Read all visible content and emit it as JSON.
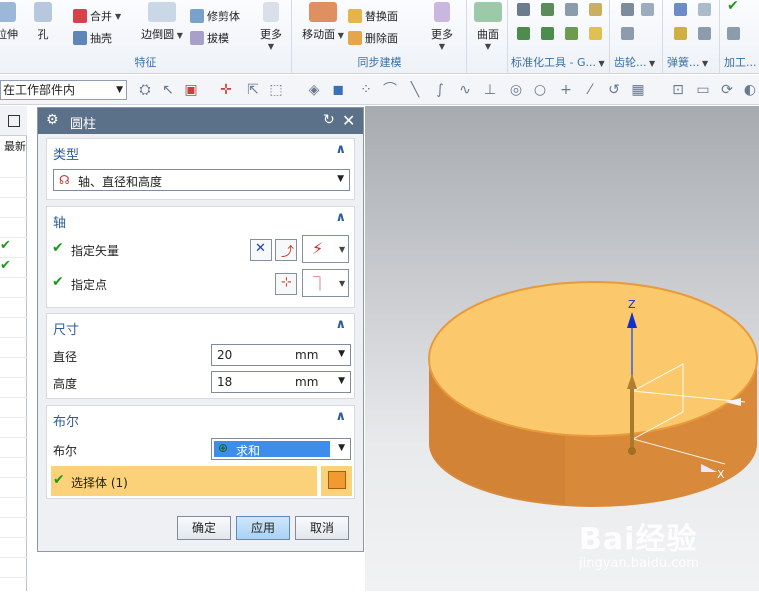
{
  "ribbon": {
    "features": {
      "label": "特征",
      "extrude_partial": "拉伸",
      "hole": "孔",
      "unite": "合并",
      "shell": "抽壳",
      "edge_blend": "边倒圆",
      "trim_body": "修剪体",
      "draft": "拔模",
      "more": "更多"
    },
    "sync": {
      "label": "同步建模",
      "move_face": "移动面",
      "replace_face": "替换面",
      "delete_face": "删除面",
      "more": "更多"
    },
    "surface": {
      "label": "曲面"
    },
    "std_tools": {
      "label": "标准化工具 - G..."
    },
    "gear": {
      "label": "齿轮..."
    },
    "spring": {
      "label": "弹簧..."
    },
    "machining": {
      "label": "加工..."
    }
  },
  "toolbar": {
    "scope": "在工作部件内"
  },
  "navigator": {
    "col_header": "最新"
  },
  "dialog": {
    "title": "圆柱",
    "type_section": {
      "title": "类型",
      "value": "轴、直径和高度"
    },
    "axis_section": {
      "title": "轴",
      "vector_label": "指定矢量",
      "point_label": "指定点"
    },
    "size_section": {
      "title": "尺寸",
      "diameter_label": "直径",
      "diameter_value": "20",
      "diameter_unit": "mm",
      "height_label": "高度",
      "height_value": "18",
      "height_unit": "mm"
    },
    "boolean_section": {
      "title": "布尔",
      "label": "布尔",
      "value": "求和",
      "select_body": "选择体 (1)"
    },
    "buttons": {
      "ok": "确定",
      "apply": "应用",
      "cancel": "取消"
    }
  },
  "viewport": {
    "axis_z": "Z",
    "axis_x": "X",
    "cylinder_color": "#f6b955"
  },
  "watermark": {
    "logo": "Bai经验",
    "url": "jingyan.baidu.com"
  }
}
